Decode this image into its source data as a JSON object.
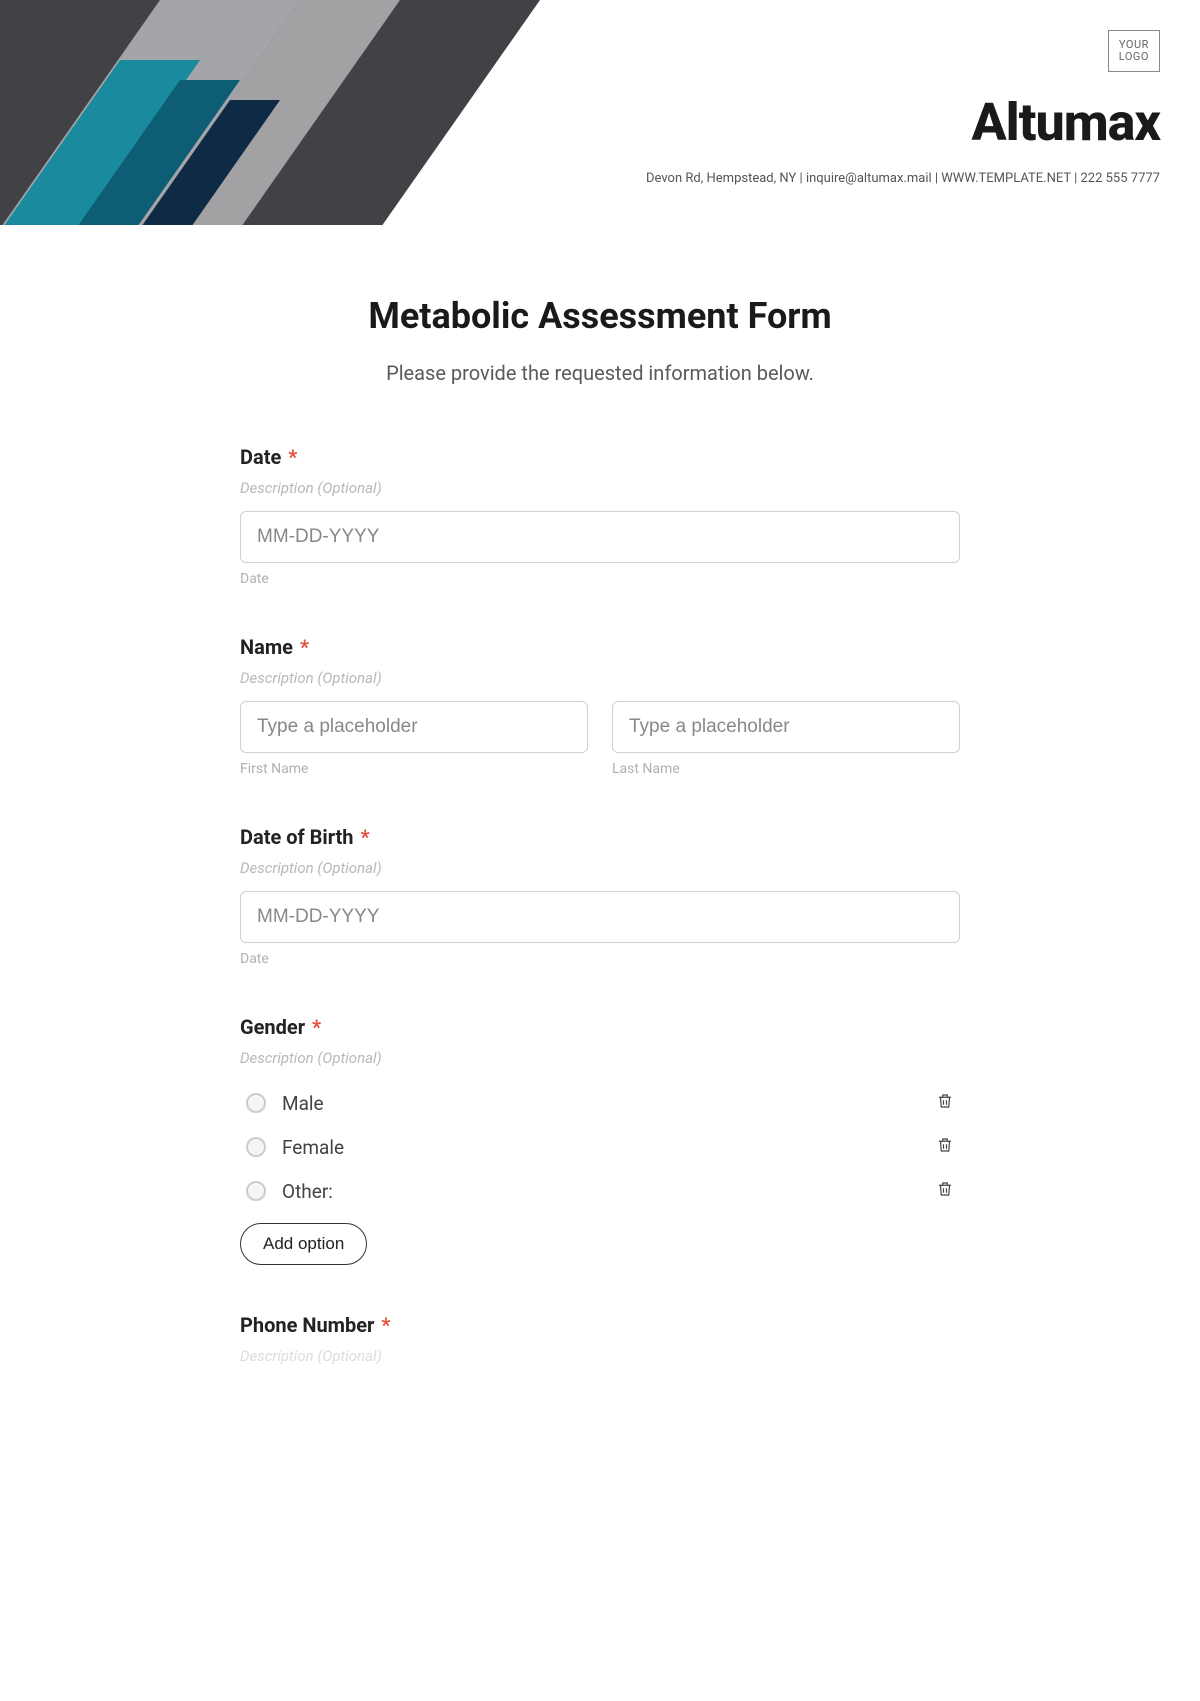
{
  "header": {
    "logo_line1": "YOUR",
    "logo_line2": "LOGO",
    "brand": "Altumax",
    "contact": "Devon Rd, Hempstead, NY | inquire@altumax.mail | WWW.TEMPLATE.NET | 222 555 7777"
  },
  "form": {
    "title": "Metabolic Assessment Form",
    "subtitle": "Please provide the requested information below.",
    "desc_placeholder": "Description (Optional)",
    "required_mark": "*",
    "fields": {
      "date": {
        "label": "Date",
        "placeholder": "MM-DD-YYYY",
        "sublabel": "Date"
      },
      "name": {
        "label": "Name",
        "first_placeholder": "Type a placeholder",
        "first_sublabel": "First Name",
        "last_placeholder": "Type a placeholder",
        "last_sublabel": "Last Name"
      },
      "dob": {
        "label": "Date of Birth",
        "placeholder": "MM-DD-YYYY",
        "sublabel": "Date"
      },
      "gender": {
        "label": "Gender",
        "options": [
          "Male",
          "Female",
          "Other:"
        ],
        "add_label": "Add option"
      },
      "phone": {
        "label": "Phone Number"
      }
    }
  }
}
